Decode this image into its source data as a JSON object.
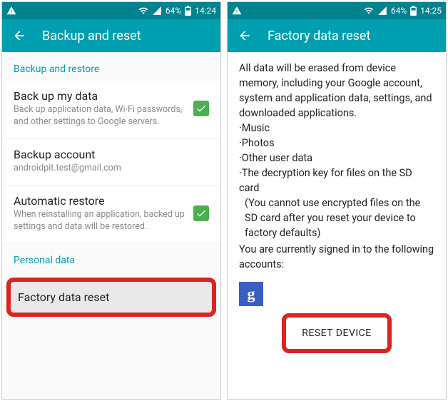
{
  "left": {
    "status": {
      "battery": "64%",
      "time": "14:24"
    },
    "title": "Backup and reset",
    "section_backup": "Backup and restore",
    "items": {
      "backup_data": {
        "title": "Back up my data",
        "sub": "Back up application data, Wi-Fi passwords, and other settings to Google servers."
      },
      "backup_account": {
        "title": "Backup account",
        "sub": "androidpit.test@gmail.com"
      },
      "auto_restore": {
        "title": "Automatic restore",
        "sub": "When reinstalling an application, backed up settings and data will be restored."
      }
    },
    "section_personal": "Personal data",
    "factory_reset": "Factory data reset"
  },
  "right": {
    "status": {
      "battery": "64%",
      "time": "14:25"
    },
    "title": "Factory data reset",
    "intro": "All data will be erased from device memory, including your Google account, system and application data, settings, and downloaded applications.",
    "bullets": {
      "music": "·Music",
      "photos": "·Photos",
      "other": "·Other user data",
      "sdkey": "·The decryption key for files on the SD card",
      "sdkey_note": "(You cannot use encrypted files on the SD card after you reset your device to factory defaults)"
    },
    "signed_in": "You are currently signed in to the following accounts:",
    "google_glyph": "g",
    "reset_button": "RESET DEVICE"
  }
}
